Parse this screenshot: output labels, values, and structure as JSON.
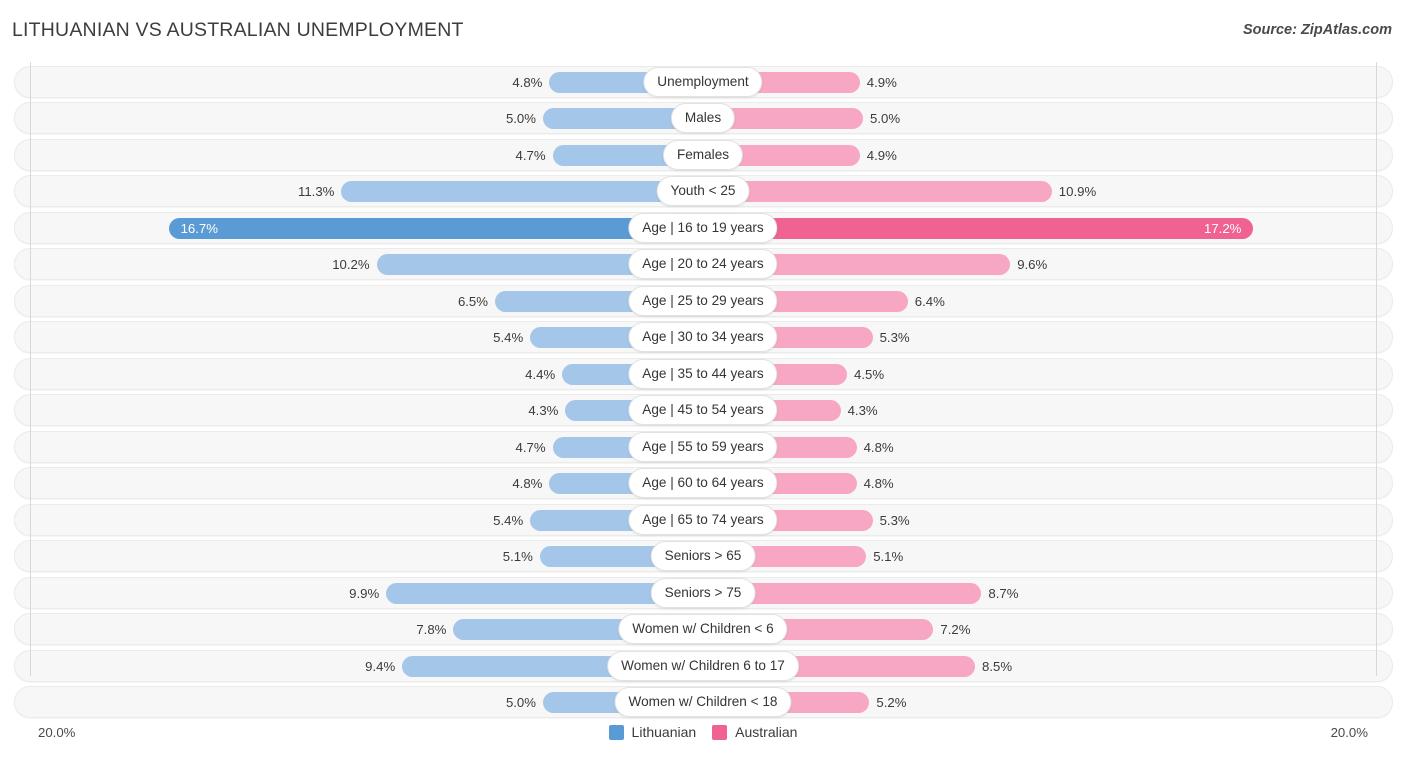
{
  "header": {
    "title": "LITHUANIAN VS AUSTRALIAN UNEMPLOYMENT",
    "source": "Source: ZipAtlas.com"
  },
  "axis": {
    "min_label": "20.0%",
    "max_label": "20.0%"
  },
  "legend": {
    "items": [
      {
        "label": "Lithuanian",
        "color": "#5b9bd5"
      },
      {
        "label": "Australian",
        "color": "#ef6292"
      }
    ]
  },
  "colors": {
    "left_normal": "#a3c6e9",
    "right_normal": "#f7a6c4",
    "left_max": "#5b9bd5",
    "right_max": "#ef6292",
    "track": "#f7f7f7",
    "gridline": "#d8d8d8"
  },
  "chart_data": {
    "type": "bar",
    "orientation": "horizontal-diverging",
    "title": "LITHUANIAN VS AUSTRALIAN UNEMPLOYMENT",
    "xlabel": "",
    "ylabel": "",
    "xlim": [
      20.0,
      20.0
    ],
    "grid": true,
    "legend_position": "bottom-center",
    "axis_max_percent": 20.0,
    "categories": [
      "Unemployment",
      "Males",
      "Females",
      "Youth < 25",
      "Age | 16 to 19 years",
      "Age | 20 to 24 years",
      "Age | 25 to 29 years",
      "Age | 30 to 34 years",
      "Age | 35 to 44 years",
      "Age | 45 to 54 years",
      "Age | 55 to 59 years",
      "Age | 60 to 64 years",
      "Age | 65 to 74 years",
      "Seniors > 65",
      "Seniors > 75",
      "Women w/ Children < 6",
      "Women w/ Children 6 to 17",
      "Women w/ Children < 18"
    ],
    "series": [
      {
        "name": "Lithuanian",
        "values": [
          4.8,
          5.0,
          4.7,
          11.3,
          16.7,
          10.2,
          6.5,
          5.4,
          4.4,
          4.3,
          4.7,
          4.8,
          5.4,
          5.1,
          9.9,
          7.8,
          9.4,
          5.0
        ]
      },
      {
        "name": "Australian",
        "values": [
          4.9,
          5.0,
          4.9,
          10.9,
          17.2,
          9.6,
          6.4,
          5.3,
          4.5,
          4.3,
          4.8,
          4.8,
          5.3,
          5.1,
          8.7,
          7.2,
          8.5,
          5.2
        ]
      }
    ]
  },
  "rows": [
    {
      "label": "Unemployment",
      "left": "4.8%",
      "right": "4.9%",
      "lv": 4.8,
      "rv": 4.9,
      "max": false
    },
    {
      "label": "Males",
      "left": "5.0%",
      "right": "5.0%",
      "lv": 5.0,
      "rv": 5.0,
      "max": false
    },
    {
      "label": "Females",
      "left": "4.7%",
      "right": "4.9%",
      "lv": 4.7,
      "rv": 4.9,
      "max": false
    },
    {
      "label": "Youth < 25",
      "left": "11.3%",
      "right": "10.9%",
      "lv": 11.3,
      "rv": 10.9,
      "max": false
    },
    {
      "label": "Age | 16 to 19 years",
      "left": "16.7%",
      "right": "17.2%",
      "lv": 16.7,
      "rv": 17.2,
      "max": true
    },
    {
      "label": "Age | 20 to 24 years",
      "left": "10.2%",
      "right": "9.6%",
      "lv": 10.2,
      "rv": 9.6,
      "max": false
    },
    {
      "label": "Age | 25 to 29 years",
      "left": "6.5%",
      "right": "6.4%",
      "lv": 6.5,
      "rv": 6.4,
      "max": false
    },
    {
      "label": "Age | 30 to 34 years",
      "left": "5.4%",
      "right": "5.3%",
      "lv": 5.4,
      "rv": 5.3,
      "max": false
    },
    {
      "label": "Age | 35 to 44 years",
      "left": "4.4%",
      "right": "4.5%",
      "lv": 4.4,
      "rv": 4.5,
      "max": false
    },
    {
      "label": "Age | 45 to 54 years",
      "left": "4.3%",
      "right": "4.3%",
      "lv": 4.3,
      "rv": 4.3,
      "max": false
    },
    {
      "label": "Age | 55 to 59 years",
      "left": "4.7%",
      "right": "4.8%",
      "lv": 4.7,
      "rv": 4.8,
      "max": false
    },
    {
      "label": "Age | 60 to 64 years",
      "left": "4.8%",
      "right": "4.8%",
      "lv": 4.8,
      "rv": 4.8,
      "max": false
    },
    {
      "label": "Age | 65 to 74 years",
      "left": "5.4%",
      "right": "5.3%",
      "lv": 5.4,
      "rv": 5.3,
      "max": false
    },
    {
      "label": "Seniors > 65",
      "left": "5.1%",
      "right": "5.1%",
      "lv": 5.1,
      "rv": 5.1,
      "max": false
    },
    {
      "label": "Seniors > 75",
      "left": "9.9%",
      "right": "8.7%",
      "lv": 9.9,
      "rv": 8.7,
      "max": false
    },
    {
      "label": "Women w/ Children < 6",
      "left": "7.8%",
      "right": "7.2%",
      "lv": 7.8,
      "rv": 7.2,
      "max": false
    },
    {
      "label": "Women w/ Children 6 to 17",
      "left": "9.4%",
      "right": "8.5%",
      "lv": 9.4,
      "rv": 8.5,
      "max": false
    },
    {
      "label": "Women w/ Children < 18",
      "left": "5.0%",
      "right": "5.2%",
      "lv": 5.0,
      "rv": 5.2,
      "max": false
    }
  ]
}
